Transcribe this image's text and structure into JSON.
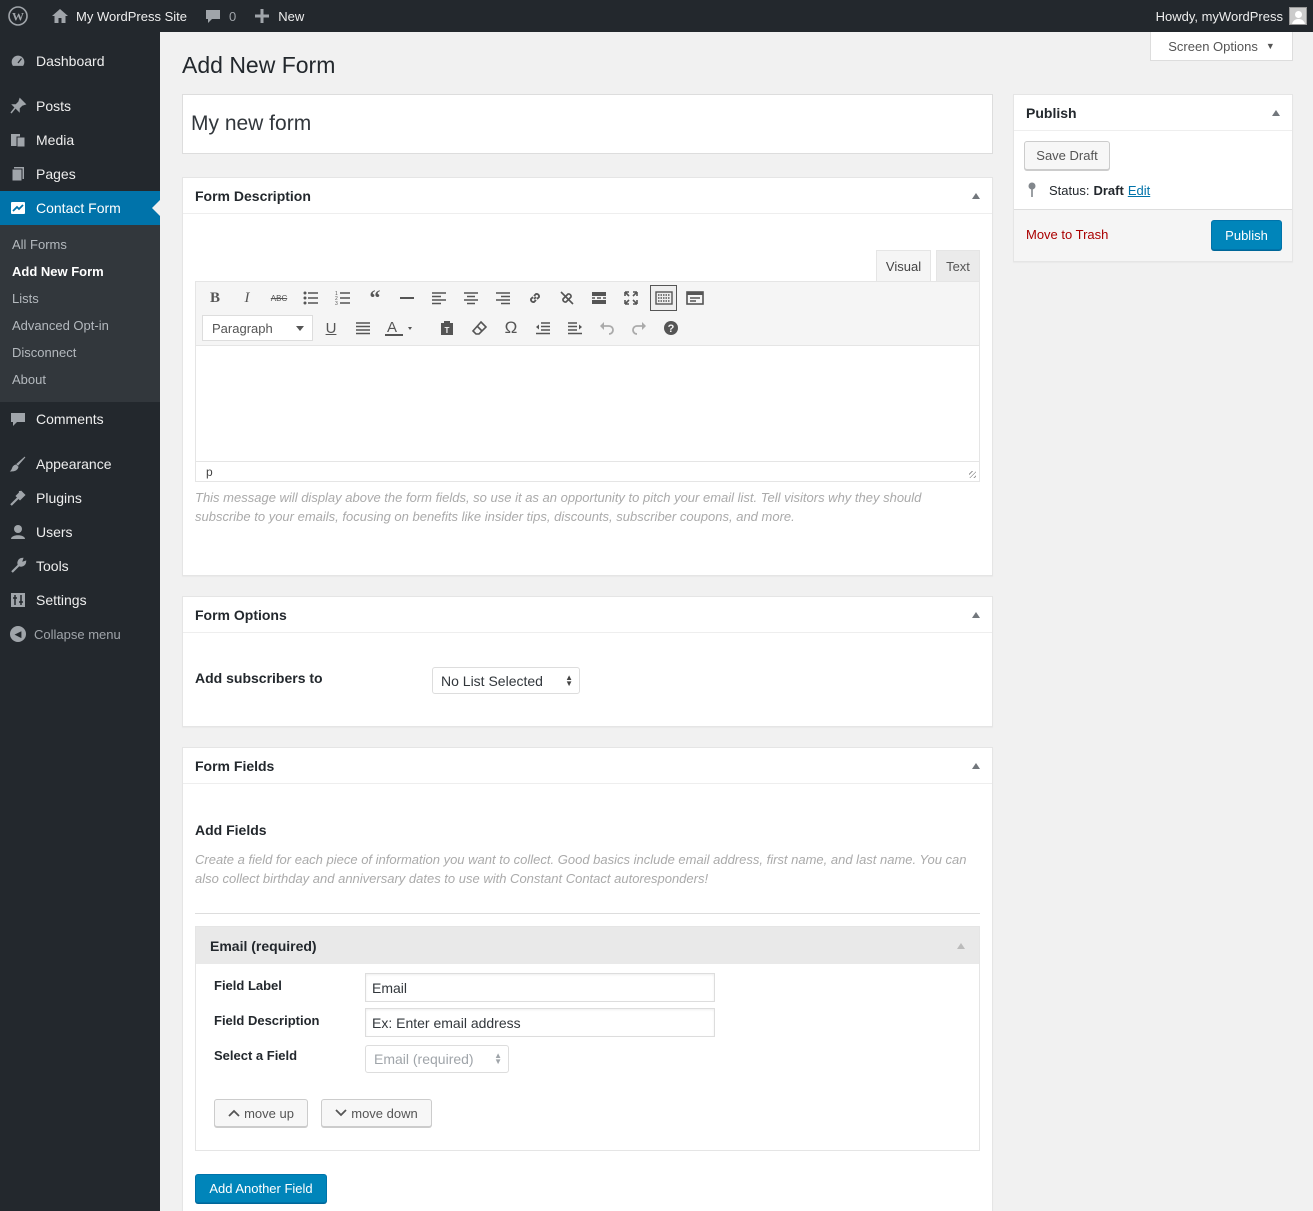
{
  "admin_bar": {
    "site_name": "My WordPress Site",
    "comments_count": "0",
    "new_label": "New",
    "greeting": "Howdy, myWordPress"
  },
  "sidebar": {
    "items": [
      {
        "label": "Dashboard",
        "icon": "dashboard-icon"
      },
      {
        "label": "Posts",
        "icon": "pin-icon"
      },
      {
        "label": "Media",
        "icon": "media-icon"
      },
      {
        "label": "Pages",
        "icon": "pages-icon"
      },
      {
        "label": "Contact Form",
        "icon": "contact-form-icon"
      },
      {
        "label": "Comments",
        "icon": "comment-icon"
      },
      {
        "label": "Appearance",
        "icon": "brush-icon"
      },
      {
        "label": "Plugins",
        "icon": "plugin-icon"
      },
      {
        "label": "Users",
        "icon": "user-icon"
      },
      {
        "label": "Tools",
        "icon": "wrench-icon"
      },
      {
        "label": "Settings",
        "icon": "settings-icon"
      }
    ],
    "submenu": [
      "All Forms",
      "Add New Form",
      "Lists",
      "Advanced Opt-in",
      "Disconnect",
      "About"
    ],
    "collapse_label": "Collapse menu"
  },
  "screen_options": "Screen Options",
  "page_title": "Add New Form",
  "form_title_value": "My new form",
  "form_description": {
    "heading": "Form Description",
    "tab_visual": "Visual",
    "tab_text": "Text",
    "format_value": "Paragraph",
    "path": "p",
    "help": "This message will display above the form fields, so use it as an opportunity to pitch your email list. Tell visitors why they should subscribe to your emails, focusing on benefits like insider tips, discounts, subscriber coupons, and more."
  },
  "form_options": {
    "heading": "Form Options",
    "add_subscribers_label": "Add subscribers to",
    "list_value": "No List Selected"
  },
  "form_fields": {
    "heading": "Form Fields",
    "add_fields_heading": "Add Fields",
    "help": "Create a field for each piece of information you want to collect. Good basics include email address, first name, and last name. You can also collect birthday and anniversary dates to use with Constant Contact autoresponders!",
    "field": {
      "title": "Email (required)",
      "field_label_label": "Field Label",
      "field_label_value": "Email",
      "field_description_label": "Field Description",
      "field_description_value": "Ex: Enter email address",
      "select_field_label": "Select a Field",
      "select_field_value": "Email (required)",
      "move_up": "move up",
      "move_down": "move down"
    },
    "add_another": "Add Another Field"
  },
  "publish": {
    "heading": "Publish",
    "save_draft": "Save Draft",
    "status_label": "Status:",
    "status_value": "Draft",
    "edit_link": "Edit",
    "trash": "Move to Trash",
    "publish_button": "Publish"
  },
  "colors": {
    "admin_bar_bg": "#23282d",
    "accent": "#0073aa",
    "primary_button": "#0085ba",
    "trash_red": "#a00"
  }
}
